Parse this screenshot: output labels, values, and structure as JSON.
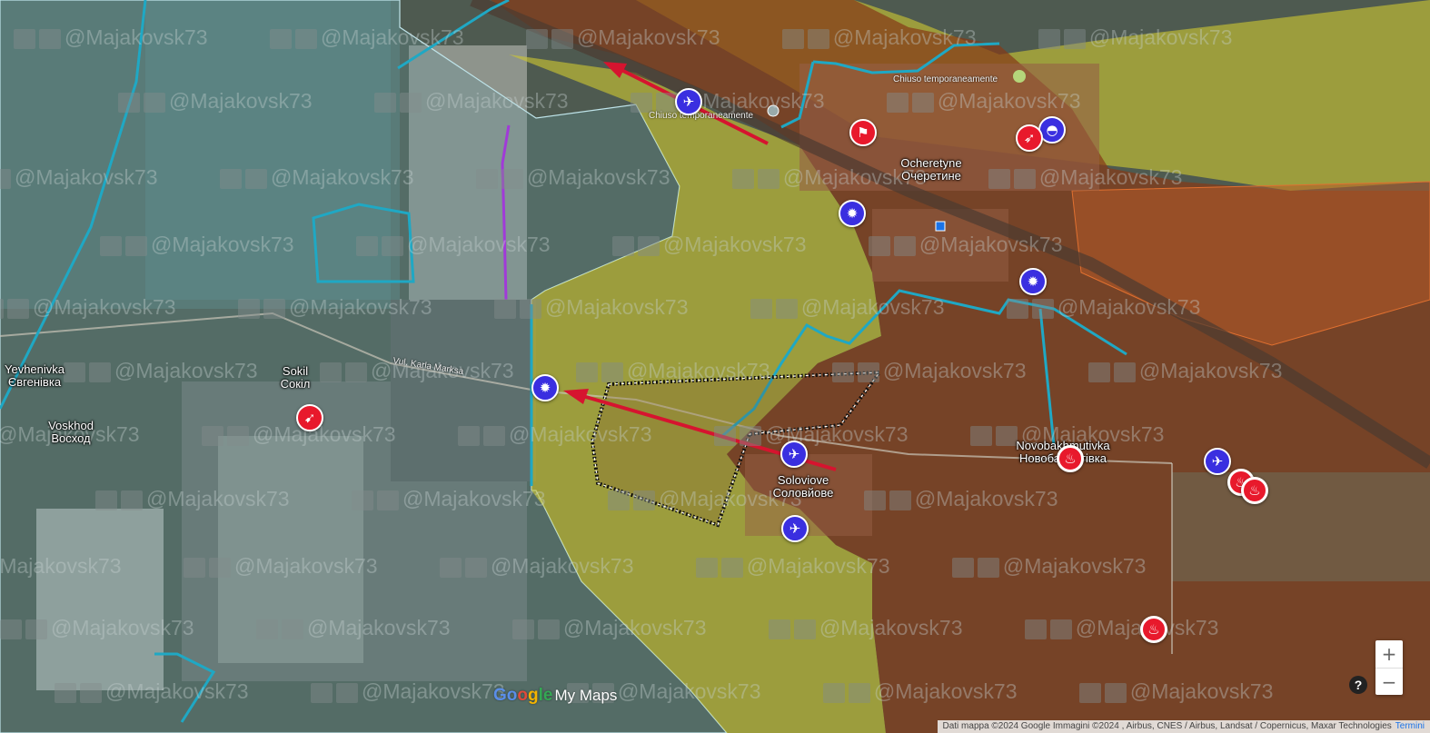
{
  "map": {
    "places": {
      "ocheretyne": {
        "latin": "Ocheretyne",
        "cyrillic": "Очеретине"
      },
      "novobakhmutivka": {
        "latin": "Novobakhmutivka",
        "cyrillic": "Новобахмутівка"
      },
      "soloviove": {
        "latin": "Soloviove",
        "cyrillic": "Соловйове"
      },
      "sokil": {
        "latin": "Sokil",
        "cyrillic": "Сокіл"
      },
      "voskhod": {
        "latin": "Voskhod",
        "cyrillic": "Восход"
      },
      "yevhenivka": {
        "latin": "Yevhenivka",
        "cyrillic": "Євгенівка"
      }
    },
    "road_labels": {
      "karla_marksa": "Vul. Karla Marksa",
      "closed_1": "Chiuso temporaneamente",
      "closed_2": "Chiuso temporaneamente"
    },
    "watermark": "@Majakovsk73",
    "logo": {
      "g1": "Go",
      "g2": "o",
      "g3": "g",
      "g4": "le",
      "suffix": "My Maps"
    },
    "zoom": {
      "in": "+",
      "out": "−"
    },
    "help": "?",
    "attribution": "Dati mappa ©2024 Google Immagini ©2024 , Airbus, CNES / Airbus, Landsat / Copernicus, Maxar Technologies",
    "terms": "Termini",
    "colors": {
      "russian_control": "#8b3b1c",
      "contested_yellow": "#c8c230",
      "frontline_cyan": "#1fa8c4",
      "attack_arrow": "#d6142f",
      "marker_blue": "#3a2fe0",
      "marker_red": "#e8192c",
      "purple_line": "#a13ad8"
    },
    "markers": [
      {
        "icon": "drone-strike-icon",
        "color": "blue"
      },
      {
        "icon": "drone-strike-icon",
        "color": "blue"
      },
      {
        "icon": "drone-strike-icon",
        "color": "blue"
      },
      {
        "icon": "drone-strike-icon",
        "color": "blue"
      },
      {
        "icon": "explosion-icon",
        "color": "blue"
      },
      {
        "icon": "explosion-icon",
        "color": "blue"
      },
      {
        "icon": "explosion-icon",
        "color": "blue"
      },
      {
        "icon": "helmet-icon",
        "color": "blue"
      },
      {
        "icon": "flag-icon",
        "color": "red"
      },
      {
        "icon": "missile-icon",
        "color": "red"
      },
      {
        "icon": "artillery-icon",
        "color": "red"
      },
      {
        "icon": "burning-tank-icon",
        "color": "red"
      },
      {
        "icon": "burning-tank-icon",
        "color": "red"
      },
      {
        "icon": "burning-tank-icon",
        "color": "red"
      },
      {
        "icon": "burning-tank-icon",
        "color": "red"
      }
    ]
  }
}
